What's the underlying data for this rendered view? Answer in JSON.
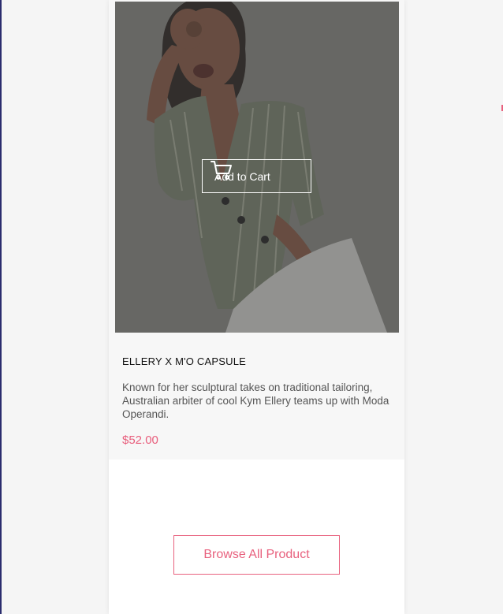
{
  "product": {
    "add_to_cart_label": "Add to Cart",
    "title": "ELLERY X M'O CAPSULE",
    "description": "Known for her sculptural takes on traditional tailoring, Australian arbiter of cool Kym Ellery teams up with Moda Operandi.",
    "price": "$52.00"
  },
  "browse_button_label": "Browse All Product",
  "colors": {
    "accent": "#e8617e",
    "card_bg": "#f7f7f7",
    "page_bg": "#f5f5f5"
  },
  "icons": {
    "cart": "shopping-cart-icon"
  }
}
